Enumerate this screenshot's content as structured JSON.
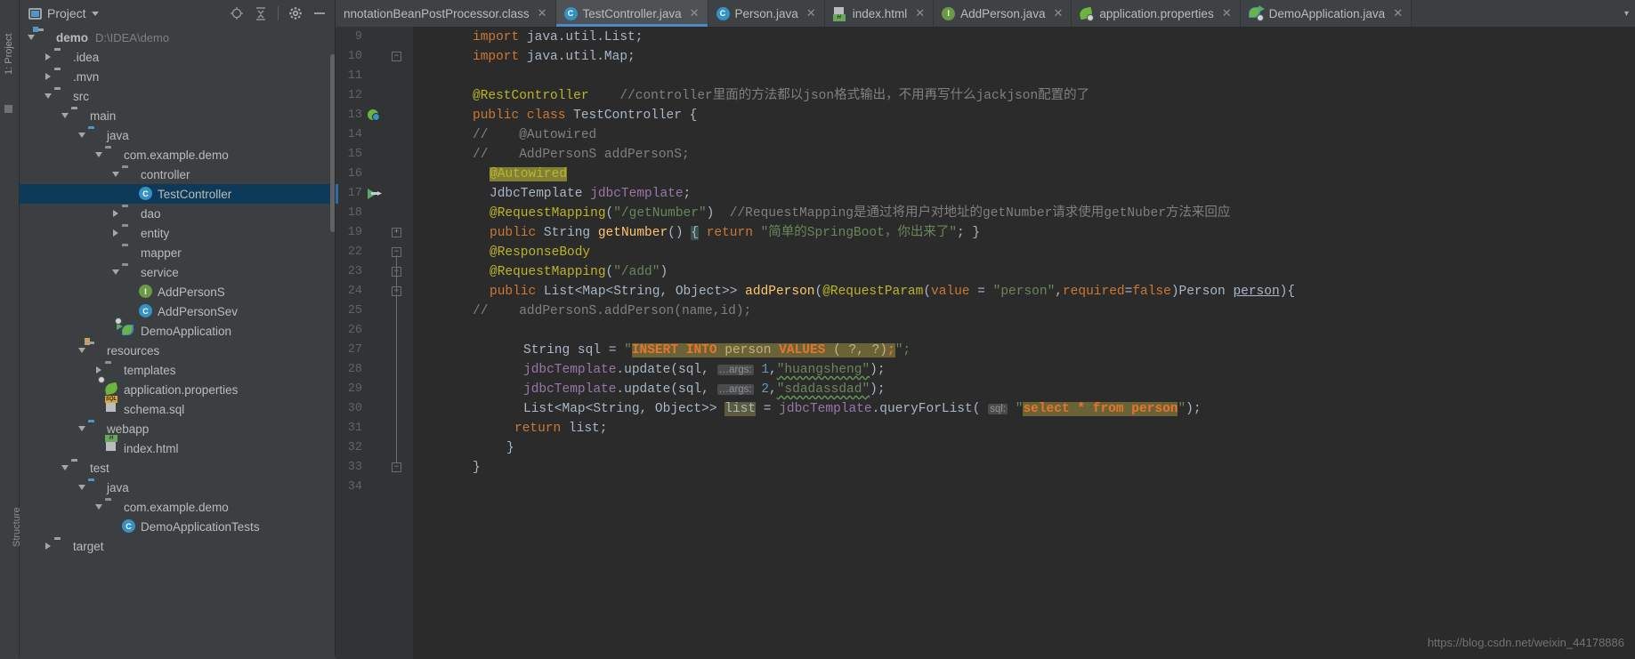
{
  "window": {
    "left_strip_label": "1: Project",
    "left_strip_label2": "Structure"
  },
  "project_panel": {
    "title": "Project",
    "tools": [
      "locate-icon",
      "collapse-all-icon",
      "settings-icon",
      "hide-icon"
    ],
    "tree": [
      {
        "indent": 0,
        "arrow": "down",
        "icon": "folder-module",
        "label": "demo",
        "bold": true,
        "sub": "D:\\IDEA\\demo"
      },
      {
        "indent": 1,
        "arrow": "right",
        "icon": "folder",
        "label": ".idea"
      },
      {
        "indent": 1,
        "arrow": "right",
        "icon": "folder",
        "label": ".mvn"
      },
      {
        "indent": 1,
        "arrow": "down",
        "icon": "folder",
        "label": "src"
      },
      {
        "indent": 2,
        "arrow": "down",
        "icon": "folder",
        "label": "main"
      },
      {
        "indent": 3,
        "arrow": "down",
        "icon": "folder-source",
        "label": "java"
      },
      {
        "indent": 4,
        "arrow": "down",
        "icon": "package",
        "label": "com.example.demo"
      },
      {
        "indent": 5,
        "arrow": "down",
        "icon": "package",
        "label": "controller"
      },
      {
        "indent": 6,
        "arrow": "none",
        "icon": "class",
        "label": "TestController",
        "selected": true
      },
      {
        "indent": 5,
        "arrow": "right",
        "icon": "package",
        "label": "dao"
      },
      {
        "indent": 5,
        "arrow": "right",
        "icon": "package",
        "label": "entity"
      },
      {
        "indent": 5,
        "arrow": "none",
        "icon": "package",
        "label": "mapper"
      },
      {
        "indent": 5,
        "arrow": "down",
        "icon": "package",
        "label": "service"
      },
      {
        "indent": 6,
        "arrow": "none",
        "icon": "interface",
        "label": "AddPersonS"
      },
      {
        "indent": 6,
        "arrow": "none",
        "icon": "class",
        "label": "AddPersonSev"
      },
      {
        "indent": 5,
        "arrow": "none",
        "icon": "spring-boot-app",
        "label": "DemoApplication"
      },
      {
        "indent": 3,
        "arrow": "down",
        "icon": "folder-resources",
        "label": "resources"
      },
      {
        "indent": 4,
        "arrow": "right",
        "icon": "package",
        "label": "templates"
      },
      {
        "indent": 4,
        "arrow": "none",
        "icon": "spring-config",
        "label": "application.properties"
      },
      {
        "indent": 4,
        "arrow": "none",
        "icon": "sql-file",
        "label": "schema.sql"
      },
      {
        "indent": 3,
        "arrow": "down",
        "icon": "folder-source",
        "label": "webapp"
      },
      {
        "indent": 4,
        "arrow": "none",
        "icon": "html-file",
        "label": "index.html"
      },
      {
        "indent": 2,
        "arrow": "down",
        "icon": "folder",
        "label": "test"
      },
      {
        "indent": 3,
        "arrow": "down",
        "icon": "folder-test",
        "label": "java"
      },
      {
        "indent": 4,
        "arrow": "down",
        "icon": "package",
        "label": "com.example.demo"
      },
      {
        "indent": 5,
        "arrow": "none",
        "icon": "class",
        "label": "DemoApplicationTests"
      },
      {
        "indent": 1,
        "arrow": "right",
        "icon": "folder",
        "label": "target"
      }
    ]
  },
  "tabs": [
    {
      "label": "nnotationBeanPostProcessor.class",
      "icon": "none",
      "active": false,
      "truncated": true
    },
    {
      "label": "TestController.java",
      "icon": "class",
      "active": true
    },
    {
      "label": "Person.java",
      "icon": "class",
      "active": false
    },
    {
      "label": "index.html",
      "icon": "html-file",
      "active": false
    },
    {
      "label": "AddPerson.java",
      "icon": "interface",
      "active": false
    },
    {
      "label": "application.properties",
      "icon": "spring-config",
      "active": false
    },
    {
      "label": "DemoApplication.java",
      "icon": "spring-boot-app",
      "active": false
    }
  ],
  "editor": {
    "gutter_numbers": [
      "9",
      "10",
      "11",
      "12",
      "13",
      "14",
      "15",
      "16",
      "17",
      "18",
      "19",
      "22",
      "23",
      "24",
      "25",
      "26",
      "27",
      "28",
      "29",
      "30",
      "31",
      "32",
      "33",
      "34"
    ],
    "current_line": "17",
    "lines": {
      "l9": "import java.util.List;",
      "l10": "import java.util.Map;",
      "l12_ann": "@RestController",
      "l12_cmt": "//controller里面的方法都以json格式输出，不用再写什么jackjson配置的了",
      "l13": "public class TestController {",
      "l14": "//    @Autowired",
      "l15": "//    AddPersonS addPersonS;",
      "l16": "@Autowired",
      "l17": "JdbcTemplate jdbcTemplate;",
      "l18_code": "@RequestMapping(\"/getNumber\")",
      "l18_cmt": "//RequestMapping是通过将用户对地址的getNumber请求使用getNuber方法来回应",
      "l19": "public String getNumber() { return \"简单的SpringBoot，你出来了\"; }",
      "l22": "@ResponseBody",
      "l23": "@RequestMapping(\"/add\")",
      "l24": "public List<Map<String, Object>> addPerson(@RequestParam(value = \"person\",required=false)Person person){",
      "l25": "//    addPersonS.addPerson(name,id);",
      "l27": "String sql = \"INSERT INTO person VALUES ( ?, ?);\";",
      "l28": "jdbcTemplate.update(sql, 1,\"huangsheng\");",
      "l29": "jdbcTemplate.update(sql, 2,\"sdadassdad\");",
      "l30": "List<Map<String, Object>> list = jdbcTemplate.queryForList( \"select * from person\");",
      "l31": "return list;",
      "l32": "}",
      "l33": "}"
    },
    "param_hints": {
      "args": "…args:",
      "sql": "sql:"
    },
    "string_literals": {
      "getNumber_path": "/getNumber",
      "add_path": "/add",
      "return_text": "简单的SpringBoot，你出来了",
      "person_value": "person",
      "insert_sql": "INSERT INTO person VALUES ( ?, ?);",
      "select_sql": "select * from person",
      "name1": "huangsheng",
      "name2": "sdadassdad"
    }
  },
  "watermark": "https://blog.csdn.net/weixin_44178886",
  "colors": {
    "accent": "#4a88c7",
    "panel_bg": "#3c3f41",
    "editor_bg": "#2b2b2b",
    "gutter_bg": "#313335",
    "selection": "#0d3a58",
    "keyword": "#cc7832",
    "string": "#6a8759",
    "annotation": "#bbb529",
    "comment": "#808080",
    "number": "#6897bb",
    "field": "#9876aa",
    "method": "#ffc66d"
  }
}
